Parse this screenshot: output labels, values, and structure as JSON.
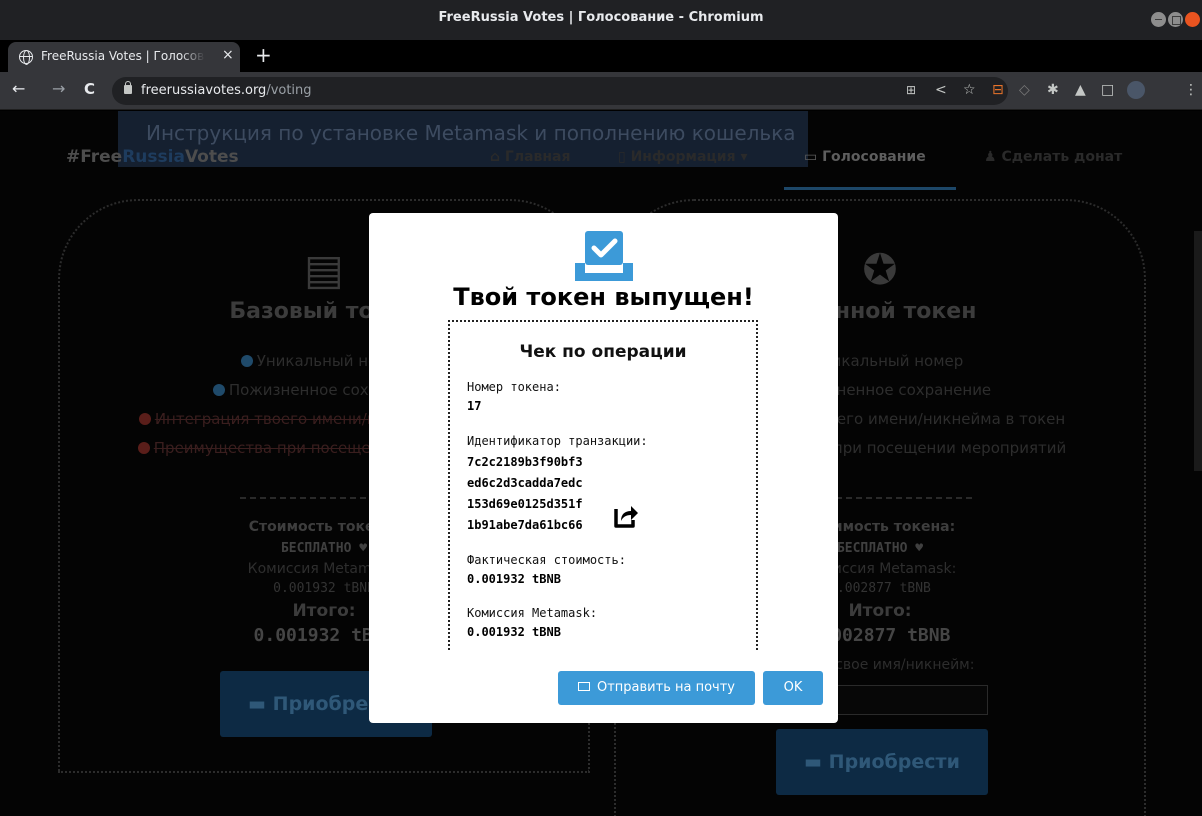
{
  "window": {
    "title": "FreeRussia Votes | Голосование - Chromium"
  },
  "tab": {
    "title": "FreeRussia Votes | Голосование",
    "close": "×",
    "new_tab": "+"
  },
  "toolbar": {
    "back": "←",
    "forward": "→",
    "reload": "C",
    "url_host": "freerussiavotes.org",
    "url_path": "/voting",
    "icons": [
      "translate-icon",
      "share-icon",
      "star-icon",
      "extension-icon",
      "shield-icon",
      "puzzle-icon",
      "flask-icon",
      "sidepanel-icon",
      "profile-icon",
      "more-icon"
    ]
  },
  "page": {
    "banner": "Инструкция по установке Metamask и пополнению кошелька",
    "logo": {
      "part1": "#Free",
      "part2": "Russia",
      "part3": "Votes"
    },
    "menu": [
      {
        "label": "Главная",
        "icon": "home-icon"
      },
      {
        "label": "Информация",
        "icon": "file-icon"
      },
      {
        "label": "Голосование",
        "icon": "vote-icon",
        "active": true
      },
      {
        "label": "Сделать донат",
        "icon": "donate-icon"
      }
    ],
    "cards": [
      {
        "title": "Базовый токен",
        "features": [
          {
            "label": "Уникальный номер",
            "included": true
          },
          {
            "label": "Пожизненное сохранение",
            "included": true
          },
          {
            "label": "Интеграция твоего имени/никнейма в токен",
            "included": false
          },
          {
            "label": "Преимущества при посещении мероприятий",
            "included": false
          }
        ],
        "cost_label": "Стоимость токена:",
        "cost_free": "БЕСПЛАТНО ♥",
        "meta_label": "Комиссия Metamask:",
        "meta_value": "0.001932 tBNB",
        "total_label": "Итого:",
        "total_value": "0.001932 tBNB",
        "buy": "Приобрести"
      },
      {
        "title": "Именной токен",
        "features": [
          {
            "label": "Уникальный номер",
            "included": true
          },
          {
            "label": "Пожизненное сохранение",
            "included": true
          },
          {
            "label": "Интеграция твоего имени/никнейма в токен",
            "included": true
          },
          {
            "label": "Преимущества при посещении мероприятий",
            "included": true
          }
        ],
        "cost_label": "Стоимость токена:",
        "cost_free": "БЕСПЛАТНО ♥",
        "meta_label": "Комиссия Metamask:",
        "meta_value": "0.002877 tBNB",
        "total_label": "Итого:",
        "total_value": "0.002877 tBNB",
        "name_label": "Введи свое имя/никнейм:",
        "name_value": "",
        "buy": "Приобрести"
      }
    ]
  },
  "modal": {
    "title": "Твой токен выпущен!",
    "receipt_title": "Чек по операции",
    "token_number_label": "Номер токена:",
    "token_number": "17",
    "tx_label": "Идентификатор транзакции:",
    "tx_lines": [
      "7c2c2189b3f90bf3",
      "ed6c2d3cadda7edc",
      "153d69e0125d351f",
      "1b91abe7da61bc66"
    ],
    "actual_cost_label": "Фактическая стоимость:",
    "actual_cost": "0.001932 tBNB",
    "fee_label": "Комиссия Metamask:",
    "fee": "0.001932 tBNB",
    "email_button": "Отправить на почту",
    "ok_button": "OK",
    "accent": "#3c9ad8"
  }
}
